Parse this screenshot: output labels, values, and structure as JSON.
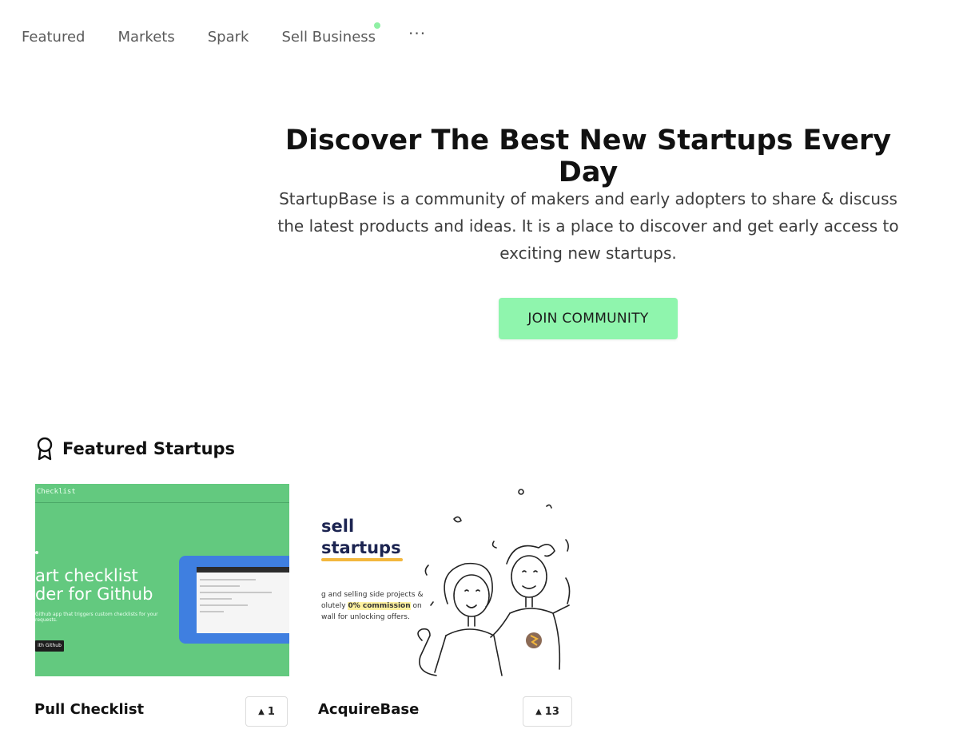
{
  "nav": {
    "items": [
      "Featured",
      "Markets",
      "Spark",
      "Sell Business"
    ],
    "more": "···"
  },
  "hero": {
    "title": "Discover The Best New Startups Every Day",
    "description": "StartupBase is a community of makers and early adopters to share & discuss the latest products and ideas. It is a place to discover and get early access to exciting new startups.",
    "button": "JOIN COMMUNITY"
  },
  "featured": {
    "heading": "Featured Startups",
    "icon": "award-ribbon-icon",
    "cards": [
      {
        "name": "Pull Checklist",
        "votes": "1",
        "image": {
          "header": "Checklist",
          "line1": "art checklist",
          "line2": "der for Github",
          "small": "Github app that triggers custom checklists for your",
          "small2": "requests.",
          "button": "ith Github"
        }
      },
      {
        "name": "AcquireBase",
        "votes": "13",
        "image": {
          "line1": "sell",
          "line2": "startups",
          "desc1": "g and selling side projects &",
          "desc2_pre": "olutely ",
          "desc2_hl": "0% commission",
          "desc2_post": " on",
          "desc3": "wall for unlocking offers."
        }
      }
    ]
  },
  "colors": {
    "accent": "#8ff5ad",
    "card1_bg": "#63c97f",
    "card1_shot": "#3f7fe0",
    "navy": "#1c2451",
    "highlight": "#f3b73d"
  }
}
